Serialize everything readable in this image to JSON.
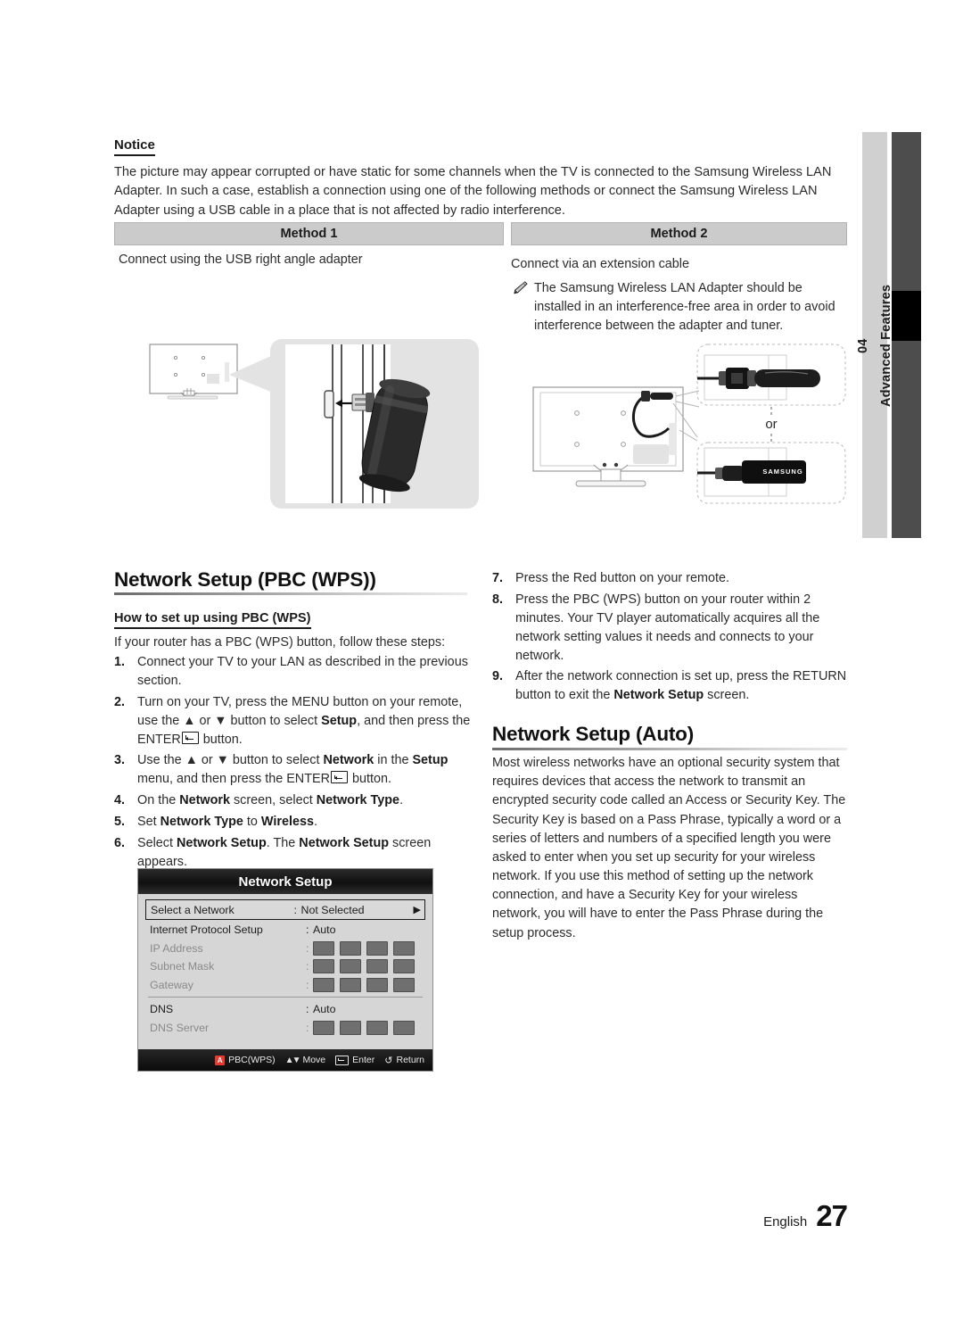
{
  "chapter": {
    "number": "04",
    "name": "Advanced Features"
  },
  "notice": {
    "heading": "Notice",
    "body": "The picture may appear corrupted or have static for some channels when the TV is connected to the Samsung Wireless LAN Adapter. In such a case, establish a connection using one of the following methods or connect the Samsung Wireless LAN Adapter using a USB cable in a place that is not affected by radio interference."
  },
  "methods": {
    "method1": {
      "header": "Method 1",
      "caption": "Connect using the USB right angle adapter"
    },
    "method2": {
      "header": "Method 2",
      "caption": "Connect via an extension cable",
      "note_icon": "pencil-note-icon",
      "note": "The Samsung Wireless LAN Adapter should be installed in an interference-free area in order to avoid interference between the adapter and tuner.",
      "or_label": "or",
      "brand_label": "SAMSUNG"
    }
  },
  "pbc_section": {
    "title": "Network Setup (PBC (WPS))",
    "subtitle": "How to set up using PBC (WPS)",
    "intro": "If your router has a PBC (WPS) button, follow these steps:",
    "steps": [
      {
        "num": "1.",
        "html": "Connect your TV to your LAN as described in the previous section."
      },
      {
        "num": "2.",
        "html": "Turn on your TV, press the MENU button on your remote, use the ▲ or ▼ button to select <b>Setup</b>, and then press the ENTER<span class=\"enterkey\"></span> button."
      },
      {
        "num": "3.",
        "html": "Use the ▲ or ▼ button to select <b>Network</b> in the <b>Setup</b> menu, and then press the ENTER<span class=\"enterkey\"></span> button."
      },
      {
        "num": "4.",
        "html": "On the <b>Network</b> screen, select <b>Network Type</b>."
      },
      {
        "num": "5.",
        "html": "Set <b>Network Type</b> to <b>Wireless</b>."
      },
      {
        "num": "6.",
        "html": "Select <b>Network Setup</b>. The <b>Network Setup</b> screen appears."
      }
    ],
    "steps_right": [
      {
        "num": "7.",
        "html": "Press the Red button on your remote."
      },
      {
        "num": "8.",
        "html": "Press the PBC (WPS) button on your router within 2 minutes. Your TV player automatically acquires all the network setting values it needs and connects to your network."
      },
      {
        "num": "9.",
        "html": "After the network connection is set up, press the RETURN button to exit the <b>Network Setup</b> screen."
      }
    ]
  },
  "auto_section": {
    "title": "Network Setup (Auto)",
    "body": "Most wireless networks have an optional security system that requires devices that access the network to transmit an encrypted security code called an Access or Security Key. The Security Key is based on a Pass Phrase, typically a word or a series of letters and numbers of a specified length you were asked to enter when you set up security for your wireless network.  If you use this method of setting up the network connection, and have a Security Key for your wireless network, you will have to enter the Pass Phrase during the setup process."
  },
  "osd": {
    "title": "Network Setup",
    "rows": [
      {
        "label": "Select a Network",
        "value": "Not Selected",
        "type": "text",
        "selected": true,
        "dim": false,
        "arrow": "▶"
      },
      {
        "label": "Internet Protocol Setup",
        "value": "Auto",
        "type": "text",
        "selected": false,
        "dim": false
      },
      {
        "label": "IP Address",
        "value": "",
        "type": "boxes",
        "selected": false,
        "dim": true
      },
      {
        "label": "Subnet Mask",
        "value": "",
        "type": "boxes",
        "selected": false,
        "dim": true
      },
      {
        "label": "Gateway",
        "value": "",
        "type": "boxes",
        "selected": false,
        "dim": true
      }
    ],
    "rows2": [
      {
        "label": "DNS",
        "value": "Auto",
        "type": "text",
        "selected": false,
        "dim": false
      },
      {
        "label": "DNS Server",
        "value": "",
        "type": "boxes",
        "selected": false,
        "dim": true
      }
    ],
    "footer": [
      {
        "key": "A",
        "label": "PBC(WPS)",
        "icon": "red-a-key-icon"
      },
      {
        "key": "↕",
        "label": "Move",
        "icon": "updown-arrows-icon"
      },
      {
        "key": "↵",
        "label": "Enter",
        "icon": "enter-key-icon"
      },
      {
        "key": "↩",
        "label": "Return",
        "icon": "return-arrow-icon"
      }
    ]
  },
  "footer": {
    "language": "English",
    "page": "27"
  },
  "colors": {
    "accent_red": "#e8392f",
    "method_header_bg": "#cbcbcb",
    "chapter_tab_bg": "#d0d0d0",
    "chapter_bar_bg": "#4d4d4d"
  }
}
